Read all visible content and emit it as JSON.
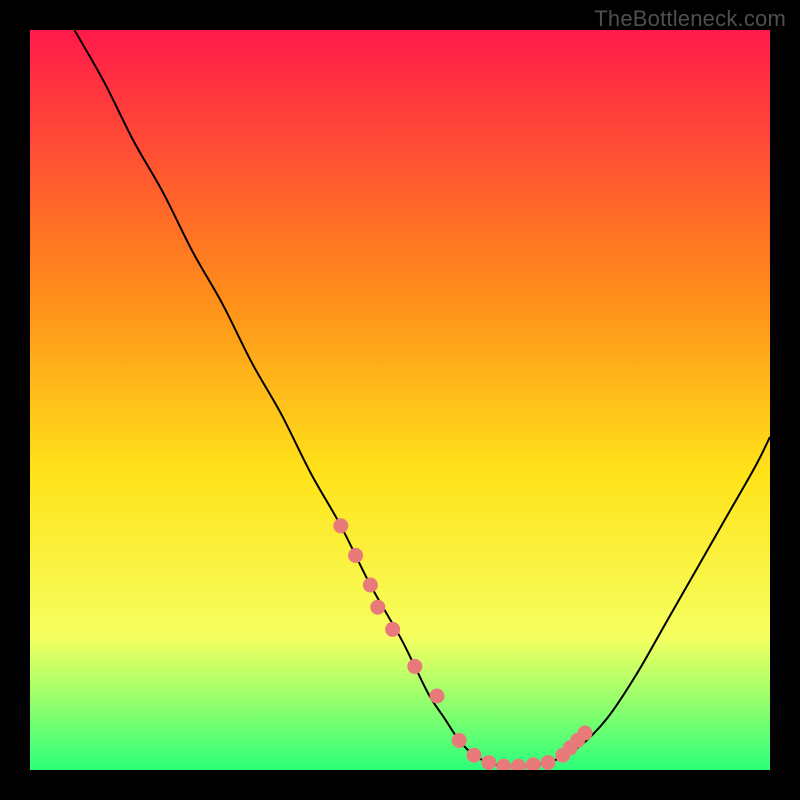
{
  "watermark": "TheBottleneck.com",
  "colors": {
    "background": "#000000",
    "gradient_top": "#ff1a4a",
    "gradient_mid1": "#ff8a1a",
    "gradient_mid2": "#ffe31a",
    "gradient_low": "#f6ff60",
    "gradient_bottom": "#2cff7a",
    "curve": "#000000",
    "dot_fill": "#e97a7a",
    "dot_stroke": "#d95f5f"
  },
  "chart_data": {
    "type": "line",
    "title": "",
    "xlabel": "",
    "ylabel": "",
    "xlim": [
      0,
      100
    ],
    "ylim": [
      0,
      100
    ],
    "series": [
      {
        "name": "bottleneck-curve",
        "x": [
          6,
          10,
          14,
          18,
          22,
          26,
          30,
          34,
          38,
          42,
          46,
          50,
          52,
          54,
          56,
          58,
          60,
          62,
          64,
          66,
          70,
          74,
          78,
          82,
          86,
          90,
          94,
          98,
          100
        ],
        "y": [
          100,
          93,
          85,
          78,
          70,
          63,
          55,
          48,
          40,
          33,
          25,
          18,
          14,
          10,
          7,
          4,
          2,
          1,
          0.5,
          0.5,
          1,
          3,
          7,
          13,
          20,
          27,
          34,
          41,
          45
        ]
      }
    ],
    "markers": {
      "name": "highlight-dots",
      "x": [
        42,
        44,
        46,
        47,
        49,
        52,
        55,
        58,
        60,
        62,
        64,
        66,
        68,
        70,
        72,
        73,
        74,
        75
      ],
      "y": [
        33,
        29,
        25,
        22,
        19,
        14,
        10,
        4,
        2,
        1,
        0.5,
        0.5,
        0.7,
        1,
        2,
        3,
        4,
        5
      ]
    }
  }
}
